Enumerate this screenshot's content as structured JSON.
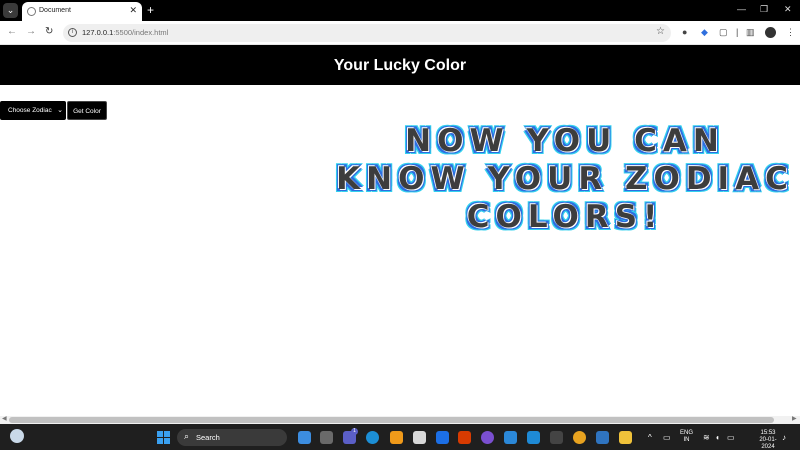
{
  "browser": {
    "tab_title": "Document",
    "url_host": "127.0.0.1",
    "url_rest": ":5500/index.html"
  },
  "page": {
    "title": "Your Lucky Color",
    "select_value": "Choose Zodiac",
    "button_label": "Get Color",
    "hero_lines": [
      "NOW YOU CAN",
      "KNOW YOUR ZODIAC",
      "COLORS!"
    ],
    "colors": {
      "header_bg": "#000000",
      "hero_fill": "#3d3d3d",
      "hero_outline_1": "#2d6ee0",
      "hero_outline_2": "#33d1ee"
    }
  },
  "taskbar": {
    "search_label": "Search",
    "lang_1": "ENG",
    "lang_2": "IN",
    "time": "15:53",
    "date": "20-01-2024",
    "badge": "1"
  }
}
